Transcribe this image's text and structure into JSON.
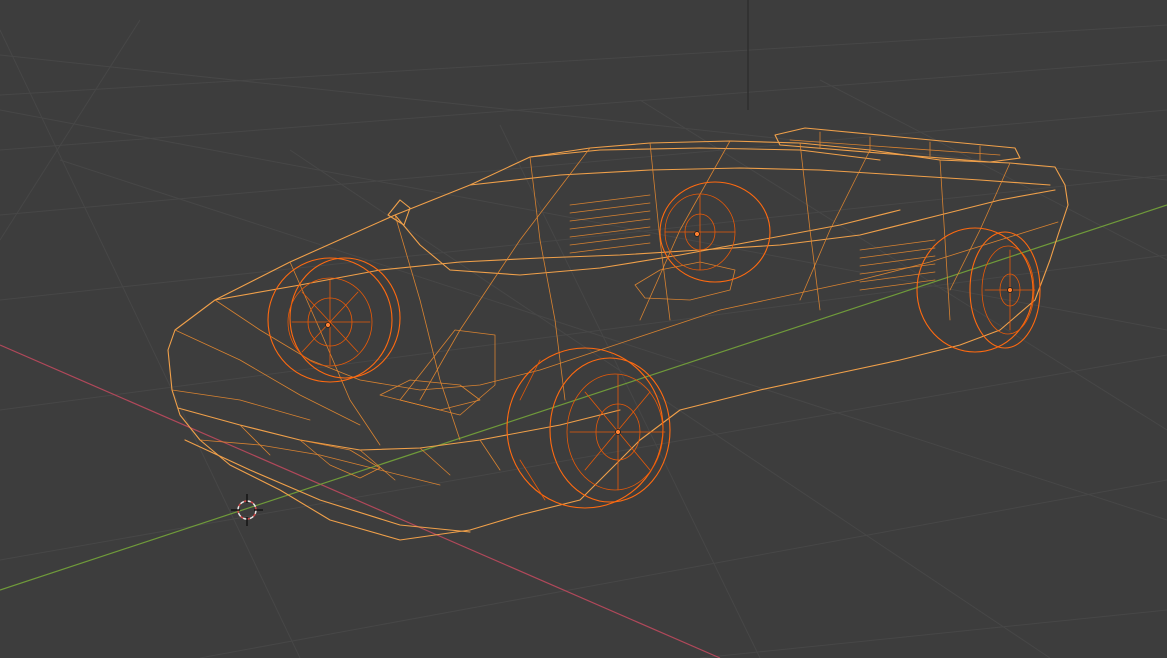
{
  "viewport": {
    "mode": "wireframe",
    "object": "sports car",
    "colors": {
      "background": "#3d3d3d",
      "grid": "#474747",
      "x_axis": "#b0485a",
      "y_axis": "#6f9a3a",
      "z_axis": "#2a2a2a",
      "selected_wire": "#f0a04a",
      "active_wire": "#ff6a10"
    },
    "icons": {
      "cursor": "3d-cursor-icon",
      "origin": "object-origin-icon"
    }
  }
}
